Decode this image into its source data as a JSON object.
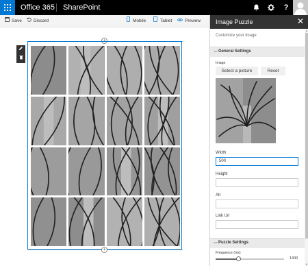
{
  "suite_bar": {
    "brand": "Office 365",
    "site": "SharePoint"
  },
  "command_bar": {
    "save": "Save",
    "discard": "Discard",
    "mobile": "Mobile",
    "tablet": "Tablet",
    "preview": "Preview"
  },
  "panel": {
    "title": "Image Puzzle",
    "description": "Customize your image",
    "general_section": "General Settings",
    "image_label": "Image",
    "select_button": "Select a picture",
    "reset_button": "Reset",
    "width_label": "Width",
    "width_value": "500",
    "height_label": "Height",
    "height_value": "",
    "alt_label": "Alt",
    "alt_value": "",
    "link_label": "Link Url",
    "link_value": "",
    "puzzle_section": "Puzzle Settings",
    "frequence_label": "Frequence (ms)",
    "frequence_value": "1300",
    "frequence_fraction": 0.33
  },
  "puzzle": {
    "rows": 4,
    "columns": 4
  },
  "colors": {
    "accent": "#0078d4",
    "suite_bar": "#000000",
    "panel_header": "#333333"
  }
}
